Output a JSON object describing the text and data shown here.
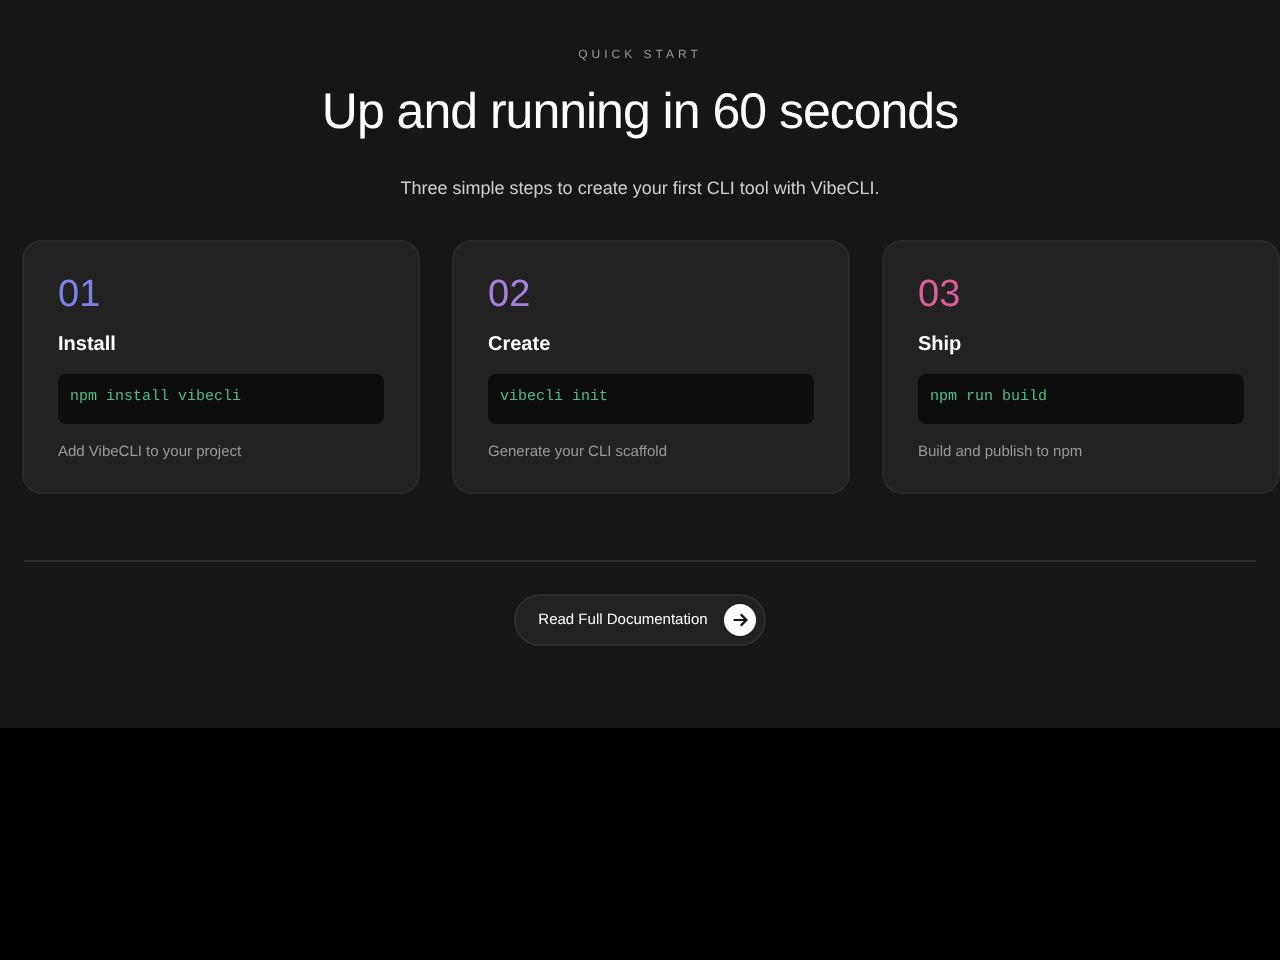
{
  "eyebrow": "QUICK START",
  "title": "Up and running in 60 seconds",
  "subtitle": "Three simple steps to create your first CLI tool with VibeCLI.",
  "steps": [
    {
      "number": "01",
      "color": "#7c83e6",
      "title": "Install",
      "command": "npm install vibecli",
      "description": "Add VibeCLI to your project"
    },
    {
      "number": "02",
      "color": "#a67fe0",
      "title": "Create",
      "command": "vibecli init",
      "description": "Generate your CLI scaffold"
    },
    {
      "number": "03",
      "color": "#dc5f9a",
      "title": "Ship",
      "command": "npm run build",
      "description": "Build and publish to npm"
    }
  ],
  "cta": {
    "label": "Read Full Documentation"
  }
}
